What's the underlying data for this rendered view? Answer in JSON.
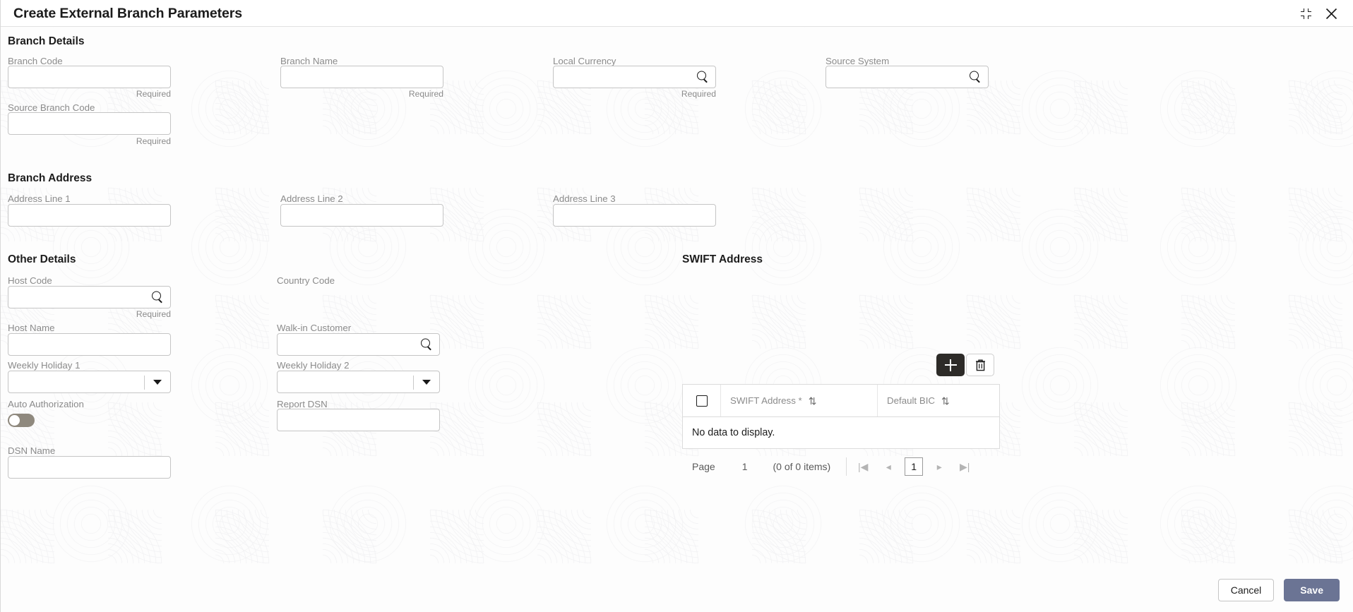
{
  "header": {
    "title": "Create External Branch Parameters",
    "collapse_icon": "collapse-corners-icon",
    "close_icon": "close-icon"
  },
  "sections": {
    "branch_details": {
      "title": "Branch Details",
      "fields": [
        {
          "label": "Branch Code",
          "value": "",
          "required_text": "Required",
          "type": "text"
        },
        {
          "label": "Branch Name",
          "value": "",
          "required_text": "Required",
          "type": "text"
        },
        {
          "label": "Local Currency",
          "value": "",
          "required_text": "Required",
          "type": "lov",
          "icon": "search-icon"
        },
        {
          "label": "Source System",
          "value": "",
          "required_text": "",
          "type": "lov",
          "icon": "search-icon"
        },
        {
          "label": "Source Branch Code",
          "value": "",
          "required_text": "Required",
          "type": "text"
        }
      ]
    },
    "branch_address": {
      "title": "Branch Address",
      "fields": [
        {
          "label": "Address Line 1",
          "value": "",
          "type": "text"
        },
        {
          "label": "Address Line 2",
          "value": "",
          "type": "text"
        },
        {
          "label": "Address Line 3",
          "value": "",
          "type": "text"
        }
      ]
    },
    "other_details": {
      "title": "Other Details",
      "fields": [
        {
          "label": "Host Code",
          "value": "",
          "required_text": "Required",
          "type": "lov",
          "icon": "search-icon"
        },
        {
          "label": "Country Code",
          "value": "",
          "required_text": "",
          "type": "label-only"
        },
        {
          "label": "Host Name",
          "value": "",
          "required_text": "",
          "type": "text"
        },
        {
          "label": "Walk-in Customer",
          "value": "",
          "required_text": "",
          "type": "lov",
          "icon": "search-icon"
        },
        {
          "label": "Weekly Holiday 1",
          "value": "",
          "required_text": "",
          "type": "select",
          "icon": "chevron-down-icon"
        },
        {
          "label": "Weekly Holiday 2",
          "value": "",
          "required_text": "",
          "type": "select",
          "icon": "chevron-down-icon"
        },
        {
          "label": "Auto Authorization",
          "value": "",
          "required_text": "",
          "type": "toggle",
          "state": "off"
        },
        {
          "label": "Report DSN",
          "value": "",
          "required_text": "",
          "type": "text"
        },
        {
          "label": "DSN Name",
          "value": "",
          "required_text": "",
          "type": "text"
        }
      ]
    },
    "swift_address": {
      "title": "SWIFT Address",
      "add_button_icon": "plus-icon",
      "delete_button_icon": "trash-icon",
      "table": {
        "columns": [
          "SWIFT Address *",
          "Default BIC"
        ],
        "sort_icon": "sort-updown-icon",
        "select_all_icon": "checkbox-icon",
        "rows": [],
        "empty_text": "No data to display."
      },
      "pagination": {
        "page_label": "Page",
        "page_value": "1",
        "items_text": "(0 of 0 items)",
        "first_icon": "|◀",
        "prev_icon": "◂",
        "current_page": "1",
        "next_icon": "▸",
        "last_icon": "▶|"
      }
    }
  },
  "footer": {
    "cancel_label": "Cancel",
    "save_label": "Save",
    "save_color": "#6b7494"
  }
}
